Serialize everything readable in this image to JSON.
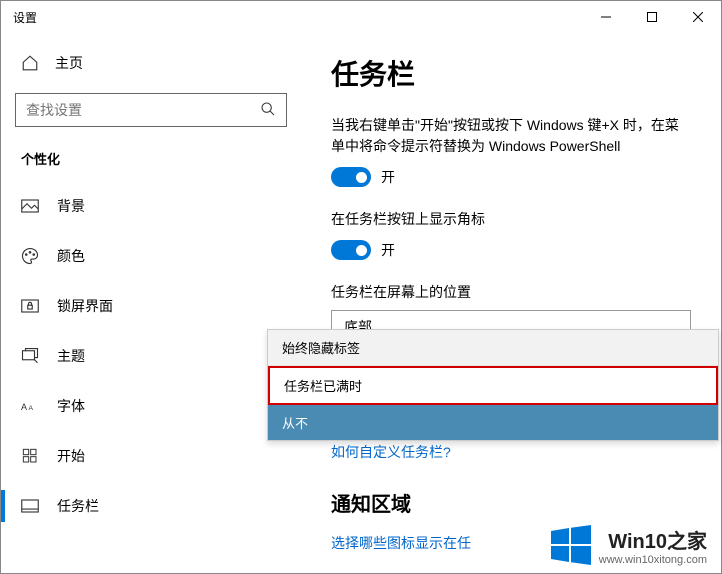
{
  "window": {
    "title": "设置"
  },
  "sidebar": {
    "home": "主页",
    "search_placeholder": "查找设置",
    "category": "个性化",
    "items": [
      {
        "label": "背景"
      },
      {
        "label": "颜色"
      },
      {
        "label": "锁屏界面"
      },
      {
        "label": "主题"
      },
      {
        "label": "字体"
      },
      {
        "label": "开始"
      },
      {
        "label": "任务栏"
      }
    ]
  },
  "main": {
    "title": "任务栏",
    "powershell_desc": "当我右键单击\"开始\"按钮或按下 Windows 键+X 时，在菜单中将命令提示符替换为 Windows PowerShell",
    "toggle_on": "开",
    "badges_label": "在任务栏按钮上显示角标",
    "position_label": "任务栏在屏幕上的位置",
    "position_value": "底部",
    "customize_link": "如何自定义任务栏?",
    "notification_heading": "通知区域",
    "notification_link": "选择哪些图标显示在任"
  },
  "dropdown": {
    "items": [
      {
        "label": "始终隐藏标签",
        "state": "normal"
      },
      {
        "label": "任务栏已满时",
        "state": "highlighted"
      },
      {
        "label": "从不",
        "state": "selected"
      }
    ]
  },
  "watermark": {
    "text": "Win10之家",
    "url": "www.win10xitong.com"
  }
}
